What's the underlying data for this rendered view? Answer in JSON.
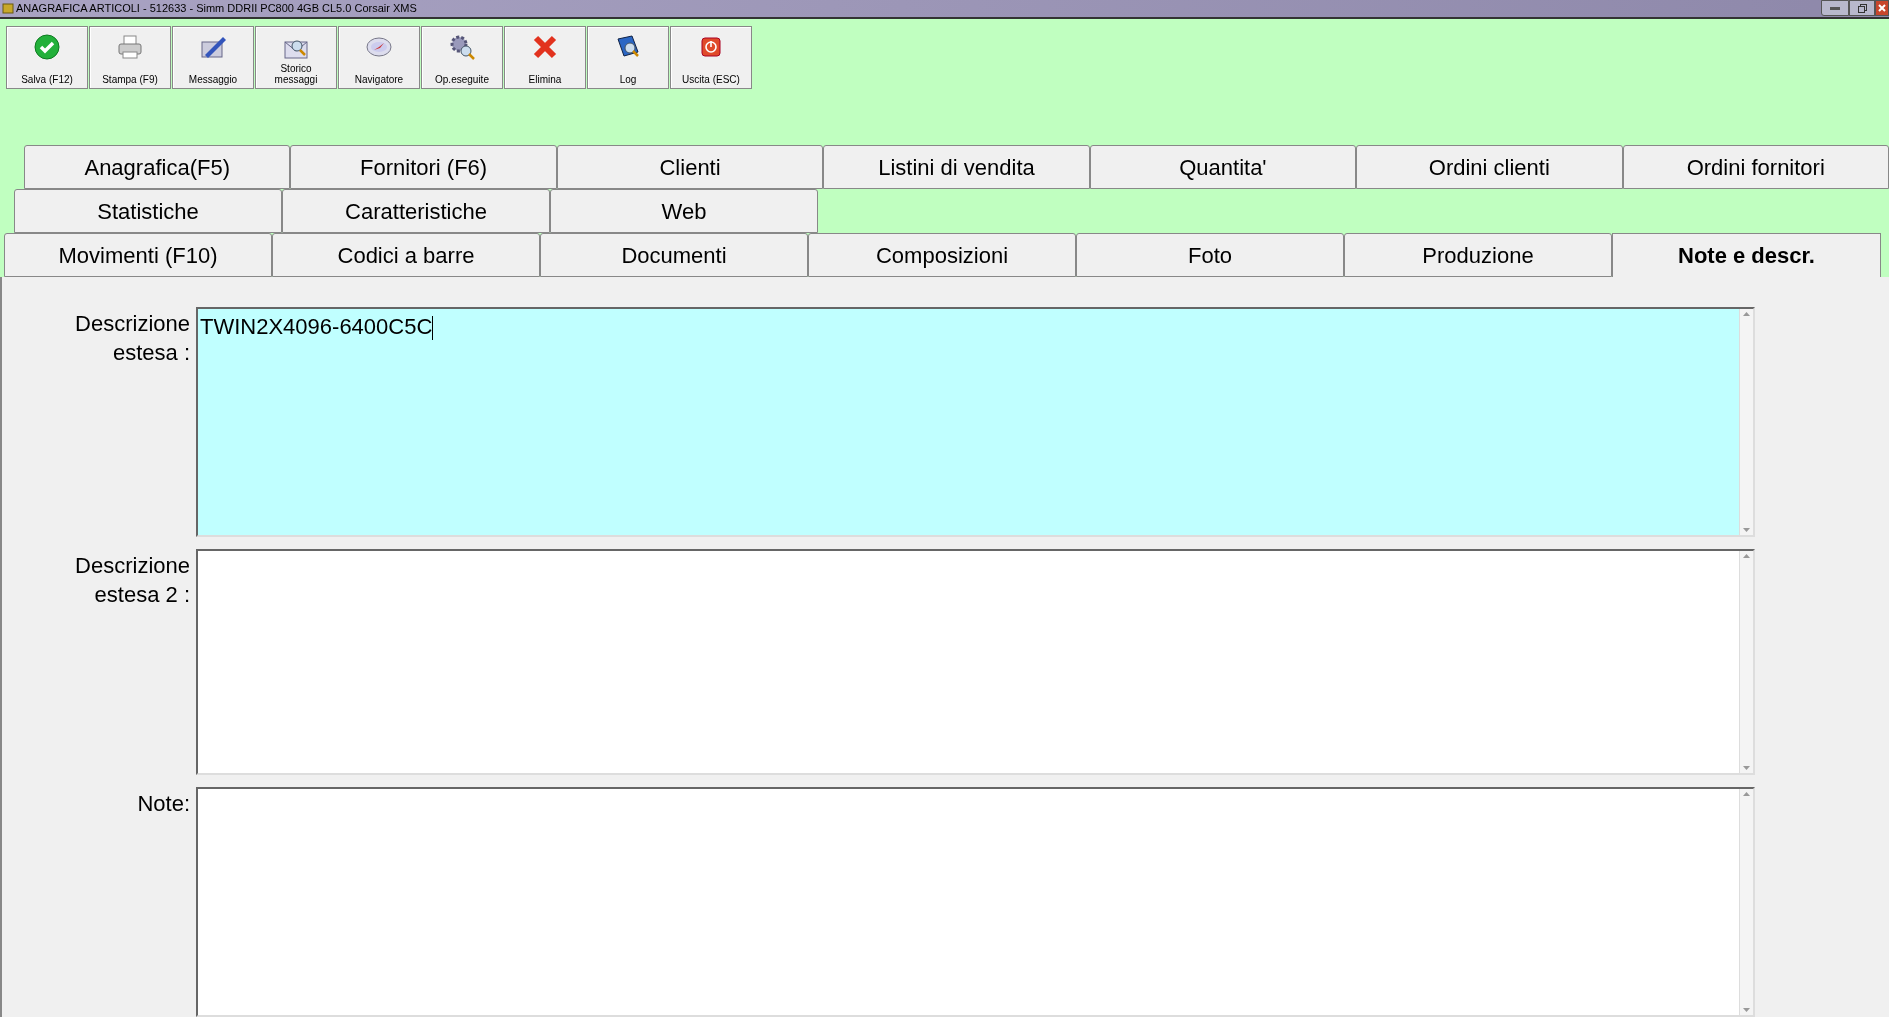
{
  "window": {
    "title": "ANAGRAFICA ARTICOLI - 512633 - Simm DDRII PC800 4GB CL5.0 Corsair XMS"
  },
  "toolbar": [
    {
      "label": "Salva (F12)",
      "kind": "check"
    },
    {
      "label": "Stampa (F9)",
      "kind": "printer"
    },
    {
      "label": "Messaggio",
      "kind": "pen"
    },
    {
      "label": "Storico messaggi",
      "kind": "envelope"
    },
    {
      "label": "Navigatore",
      "kind": "compass"
    },
    {
      "label": "Op.eseguite",
      "kind": "gears"
    },
    {
      "label": "Elimina",
      "kind": "cross"
    },
    {
      "label": "Log",
      "kind": "book"
    },
    {
      "label": "Uscita (ESC)",
      "kind": "power"
    }
  ],
  "tab_rows": [
    [
      {
        "label": "Anagrafica(F5)",
        "selected": false
      },
      {
        "label": "Fornitori (F6)",
        "selected": false
      },
      {
        "label": "Clienti",
        "selected": false
      },
      {
        "label": "Listini di vendita",
        "selected": false
      },
      {
        "label": "Quantita'",
        "selected": false
      },
      {
        "label": "Ordini clienti",
        "selected": false
      },
      {
        "label": "Ordini fornitori",
        "selected": false
      }
    ],
    [
      {
        "label": "Statistiche",
        "selected": false
      },
      {
        "label": "Caratteristiche",
        "selected": false
      },
      {
        "label": "Web",
        "selected": false
      }
    ],
    [
      {
        "label": "Movimenti (F10)",
        "selected": false
      },
      {
        "label": "Codici a barre",
        "selected": false
      },
      {
        "label": "Documenti",
        "selected": false
      },
      {
        "label": "Composizioni",
        "selected": false
      },
      {
        "label": "Foto",
        "selected": false
      },
      {
        "label": "Produzione",
        "selected": false
      },
      {
        "label": "Note e descr.",
        "selected": true
      }
    ]
  ],
  "fields": [
    {
      "label": "Descrizione estesa :",
      "value": "TWIN2X4096-6400C5C",
      "focused": true
    },
    {
      "label": "Descrizione estesa 2 :",
      "focused": false
    },
    {
      "label": "Note:",
      "focused": false
    }
  ]
}
